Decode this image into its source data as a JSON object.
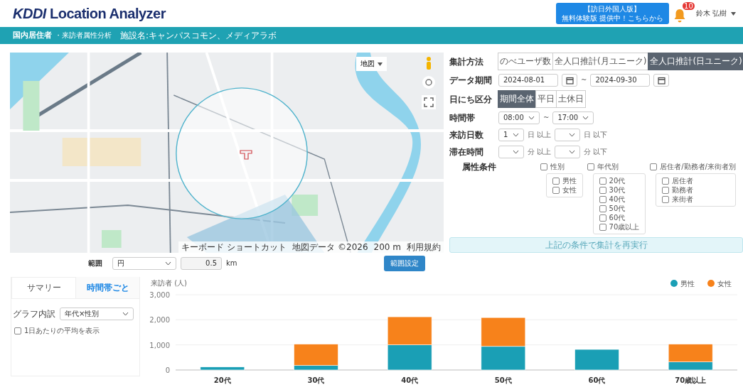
{
  "header": {
    "logo_brand": "KDDI",
    "logo_text": "Location Analyzer",
    "promo": {
      "line1": "【訪日外国人版】",
      "line2": "無料体験版 提供中！こちらから"
    },
    "notification_count": "10",
    "user": "鈴木 弘樹"
  },
  "title_bar": {
    "main": "国内居住者",
    "sub": "・来訪者属性分析",
    "facility": "施設名:キャンパスコモン、メディアラボ"
  },
  "map": {
    "kind": "picture",
    "type_button": "地図",
    "attribution": [
      "キーボード ショートカット",
      "地図データ ©2026",
      "200 m",
      "利用規約"
    ]
  },
  "range": {
    "label": "範囲",
    "shape": "円",
    "radius": "0.5",
    "unit": "km",
    "button": "範囲設定"
  },
  "aggregation": {
    "label": "集計方法",
    "options": [
      {
        "label": "のべユーザ数",
        "selected": false
      },
      {
        "label": "全人口推計(月ユニーク)",
        "selected": false
      },
      {
        "label": "全人口推計(日ユニーク)",
        "selected": true
      }
    ]
  },
  "period": {
    "label": "データ期間",
    "from": "2024-08-01",
    "separator": "~",
    "to": "2024-09-30"
  },
  "day_type": {
    "label": "日にち区分",
    "options": [
      {
        "label": "期間全体",
        "selected": true
      },
      {
        "label": "平日",
        "selected": false
      },
      {
        "label": "土休日",
        "selected": false
      }
    ]
  },
  "time_range": {
    "label": "時間帯",
    "from": "08:00",
    "separator": "~",
    "to": "17:00"
  },
  "visit_days": {
    "label": "来訪日数",
    "min": "1",
    "min_unit": "日 以上",
    "max_unit": "日 以下"
  },
  "stay_time": {
    "label": "滞在時間",
    "min_unit": "分 以上",
    "max_unit": "分 以下"
  },
  "attributes": {
    "label": "属性条件",
    "groups": [
      {
        "label": "性別",
        "checked": false,
        "items": [
          {
            "label": "男性",
            "checked": false
          },
          {
            "label": "女性",
            "checked": false
          }
        ]
      },
      {
        "label": "年代別",
        "checked": false,
        "items": [
          {
            "label": "20代",
            "checked": false
          },
          {
            "label": "30代",
            "checked": false
          },
          {
            "label": "40代",
            "checked": false
          },
          {
            "label": "50代",
            "checked": false
          },
          {
            "label": "60代",
            "checked": false
          },
          {
            "label": "70歳以上",
            "checked": false
          }
        ]
      },
      {
        "label": "居住者/勤務者/来街者別",
        "checked": false,
        "items": [
          {
            "label": "居住者",
            "checked": false
          },
          {
            "label": "勤務者",
            "checked": false
          },
          {
            "label": "来街者",
            "checked": false
          }
        ]
      }
    ]
  },
  "rerun_button": {
    "label": "上記の条件で集計を再実行",
    "disabled": true
  },
  "tabs": [
    {
      "label": "サマリー",
      "selected": true
    },
    {
      "label": "時間帯ごと",
      "selected": false
    }
  ],
  "breakdown": {
    "label": "グラフ内訳",
    "value": "年代×性別"
  },
  "daily_average": {
    "label": "1日あたりの平均を表示",
    "checked": false
  },
  "chart": {
    "chart_data": {
      "type": "bar",
      "stacked": true,
      "legend": true,
      "ylabel": "来訪者 (人)",
      "categories": [
        "20代",
        "30代",
        "40代",
        "50代",
        "60代",
        "70歳以上"
      ],
      "series": [
        {
          "name": "男性",
          "color": "#1a9fb5",
          "values": [
            120,
            180,
            1000,
            940,
            820,
            320
          ]
        },
        {
          "name": "女性",
          "color": "#f7821b",
          "values": [
            0,
            850,
            1120,
            1150,
            0,
            710
          ]
        }
      ],
      "ylim": [
        0,
        3000
      ],
      "yticks": [
        {
          "value": 0,
          "label": "0"
        },
        {
          "value": 1000,
          "label": "1,000"
        },
        {
          "value": 2000,
          "label": "2,000"
        },
        {
          "value": 3000,
          "label": "3,000"
        }
      ]
    }
  }
}
